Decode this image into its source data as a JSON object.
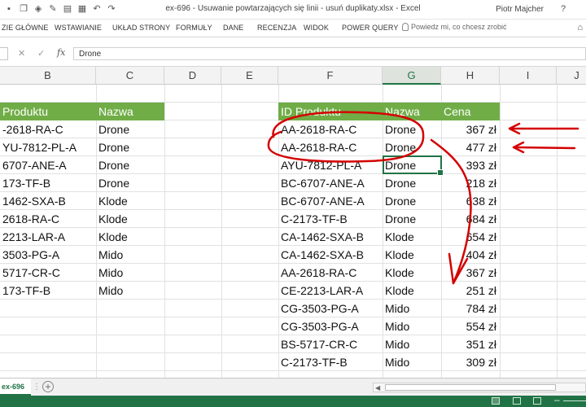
{
  "title_bar": {
    "title": "ex-696 - Usuwanie powtarzających się linii - usuń duplikaty.xlsx  -  Excel",
    "user": "Piotr Majcher",
    "help": "?"
  },
  "ribbon": {
    "tabs": [
      "ZIE GŁÓWNE",
      "WSTAWIANIE",
      "UKŁAD STRONY",
      "FORMUŁY",
      "DANE",
      "RECENZJA",
      "WIDOK",
      "POWER QUERY"
    ],
    "tell_me_placeholder": "Powiedz mi, co chcesz zrobić",
    "right_icon": "⌂"
  },
  "formula_bar": {
    "fx_label": "fx",
    "value": "Drone"
  },
  "columns": [
    "B",
    "C",
    "D",
    "E",
    "F",
    "G",
    "H",
    "I",
    "J"
  ],
  "selected_column": "G",
  "left_table": {
    "headers": [
      "Produktu",
      "Nazwa"
    ],
    "rows": [
      [
        "-2618-RA-C",
        "Drone"
      ],
      [
        "YU-7812-PL-A",
        "Drone"
      ],
      [
        "6707-ANE-A",
        "Drone"
      ],
      [
        "173-TF-B",
        "Drone"
      ],
      [
        "1462-SXA-B",
        "Klode"
      ],
      [
        "2618-RA-C",
        "Klode"
      ],
      [
        "2213-LAR-A",
        "Klode"
      ],
      [
        "3503-PG-A",
        "Mido"
      ],
      [
        "5717-CR-C",
        "Mido"
      ],
      [
        "173-TF-B",
        "Mido"
      ]
    ]
  },
  "right_table": {
    "headers": [
      "ID Produktu",
      "Nazwa",
      "Cena"
    ],
    "rows": [
      [
        "AA-2618-RA-C",
        "Drone",
        "367 zł"
      ],
      [
        "AA-2618-RA-C",
        "Drone",
        "477 zł"
      ],
      [
        "AYU-7812-PL-A",
        "Drone",
        "393 zł"
      ],
      [
        "BC-6707-ANE-A",
        "Drone",
        "218 zł"
      ],
      [
        "BC-6707-ANE-A",
        "Drone",
        "638 zł"
      ],
      [
        "C-2173-TF-B",
        "Drone",
        "684 zł"
      ],
      [
        "CA-1462-SXA-B",
        "Klode",
        "654 zł"
      ],
      [
        "CA-1462-SXA-B",
        "Klode",
        "404 zł"
      ],
      [
        "AA-2618-RA-C",
        "Klode",
        "367 zł"
      ],
      [
        "CE-2213-LAR-A",
        "Klode",
        "251 zł"
      ],
      [
        "CG-3503-PG-A",
        "Mido",
        "784 zł"
      ],
      [
        "CG-3503-PG-A",
        "Mido",
        "554 zł"
      ],
      [
        "BS-5717-CR-C",
        "Mido",
        "351 zł"
      ],
      [
        "C-2173-TF-B",
        "Mido",
        "309 zł"
      ]
    ]
  },
  "sheet_tabs": {
    "active": "ex-696"
  },
  "colors": {
    "excel_green": "#217346",
    "table_header": "#70ad47",
    "annotation_red": "#d40000"
  }
}
